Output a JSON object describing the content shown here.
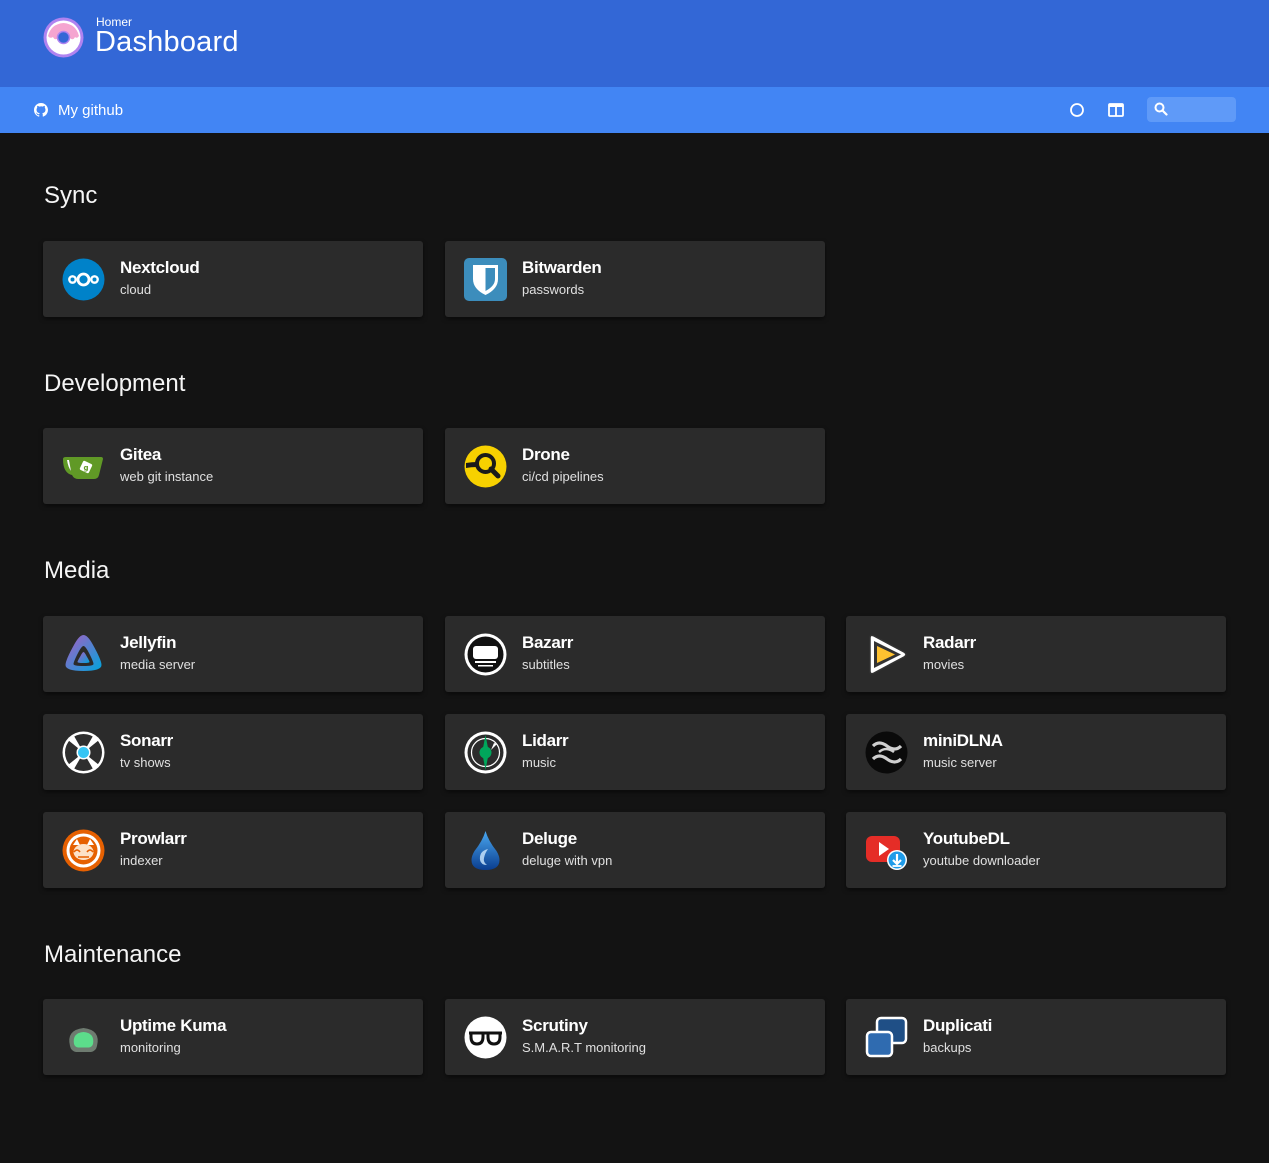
{
  "header": {
    "subtitle": "Homer",
    "title": "Dashboard"
  },
  "navbar": {
    "link_label": "My github",
    "search_placeholder": ""
  },
  "icons": {
    "logo": "donut-logo-icon",
    "github": "github-icon",
    "theme": "circle-icon",
    "layout": "columns-icon",
    "search": "search-icon"
  },
  "colors": {
    "header": "#3367d6",
    "navbar": "#4285f4",
    "background": "#131313",
    "card": "#2b2b2b"
  },
  "groups": [
    {
      "title": "Sync",
      "services": [
        {
          "name": "Nextcloud",
          "subtitle": "cloud",
          "icon": "nextcloud-icon"
        },
        {
          "name": "Bitwarden",
          "subtitle": "passwords",
          "icon": "bitwarden-icon"
        }
      ]
    },
    {
      "title": "Development",
      "services": [
        {
          "name": "Gitea",
          "subtitle": "web git instance",
          "icon": "gitea-icon"
        },
        {
          "name": "Drone",
          "subtitle": "ci/cd pipelines",
          "icon": "drone-icon"
        }
      ]
    },
    {
      "title": "Media",
      "services": [
        {
          "name": "Jellyfin",
          "subtitle": "media server",
          "icon": "jellyfin-icon"
        },
        {
          "name": "Bazarr",
          "subtitle": "subtitles",
          "icon": "bazarr-icon"
        },
        {
          "name": "Radarr",
          "subtitle": "movies",
          "icon": "radarr-icon"
        },
        {
          "name": "Sonarr",
          "subtitle": "tv shows",
          "icon": "sonarr-icon"
        },
        {
          "name": "Lidarr",
          "subtitle": "music",
          "icon": "lidarr-icon"
        },
        {
          "name": "miniDLNA",
          "subtitle": "music server",
          "icon": "minidlna-icon"
        },
        {
          "name": "Prowlarr",
          "subtitle": "indexer",
          "icon": "prowlarr-icon"
        },
        {
          "name": "Deluge",
          "subtitle": "deluge with vpn",
          "icon": "deluge-icon"
        },
        {
          "name": "YoutubeDL",
          "subtitle": "youtube downloader",
          "icon": "youtubedl-icon"
        }
      ]
    },
    {
      "title": "Maintenance",
      "services": [
        {
          "name": "Uptime Kuma",
          "subtitle": "monitoring",
          "icon": "uptime-kuma-icon"
        },
        {
          "name": "Scrutiny",
          "subtitle": "S.M.A.R.T monitoring",
          "icon": "scrutiny-icon"
        },
        {
          "name": "Duplicati",
          "subtitle": "backups",
          "icon": "duplicati-icon"
        }
      ]
    }
  ]
}
